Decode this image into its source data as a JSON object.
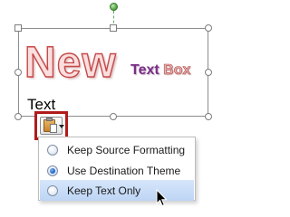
{
  "slide": {
    "wordart_big": "New",
    "wordart_small_part1": "Text",
    "wordart_small_part2": "Box",
    "pasted_text": "Text"
  },
  "paste_options": {
    "icon": "paste-clipboard-icon",
    "menu": {
      "items": [
        {
          "label": "Keep Source Formatting",
          "checked": false,
          "highlighted": false
        },
        {
          "label": "Use Destination Theme",
          "checked": true,
          "highlighted": false
        },
        {
          "label": "Keep Text Only",
          "checked": false,
          "highlighted": true
        }
      ]
    }
  },
  "colors": {
    "button_highlight_border": "#b11b1b",
    "menu_highlight": "#c9dcf7",
    "wordart_fill": "#fbdede",
    "wordart_outline": "#c44a4a",
    "small_text_purple": "#7a2f85"
  }
}
